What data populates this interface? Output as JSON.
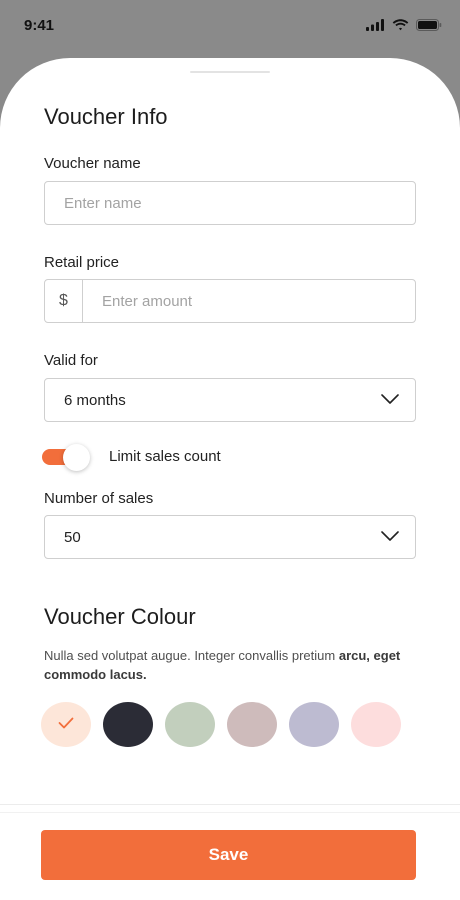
{
  "status_bar": {
    "time": "9:41",
    "icons": [
      "signal-icon",
      "wifi-icon",
      "battery-icon"
    ]
  },
  "voucher_info": {
    "title": "Voucher Info",
    "name": {
      "label": "Voucher name",
      "placeholder": "Enter name",
      "value": ""
    },
    "price": {
      "label": "Retail price",
      "currency": "$",
      "placeholder": "Enter amount",
      "value": ""
    },
    "valid_for": {
      "label": "Valid for",
      "value": "6 months"
    },
    "limit_sales": {
      "label": "Limit sales count",
      "enabled": true
    },
    "number_of_sales": {
      "label": "Number of sales",
      "value": "50"
    }
  },
  "voucher_colour": {
    "title": "Voucher Colour",
    "description": "Nulla sed volutpat augue. Integer convallis pretium ",
    "description_bold": "arcu, eget commodo lacus.",
    "selected_index": 0,
    "swatches": [
      {
        "name": "peach",
        "color": "#fde6d9"
      },
      {
        "name": "charcoal",
        "color": "#2b2c36"
      },
      {
        "name": "sage",
        "color": "#c2cfbd"
      },
      {
        "name": "mauve",
        "color": "#cebbbb"
      },
      {
        "name": "lavender",
        "color": "#bdbbd1"
      },
      {
        "name": "blush",
        "color": "#fddddd"
      }
    ]
  },
  "footer": {
    "save_label": "Save"
  },
  "colors": {
    "accent": "#f26e3b",
    "check": "#f26e3b"
  }
}
